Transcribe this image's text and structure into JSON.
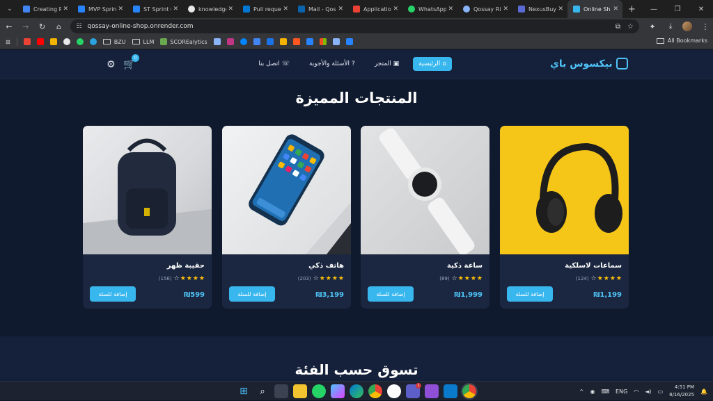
{
  "browser": {
    "tabs": [
      {
        "title": "Creating P",
        "color": "#4285f4"
      },
      {
        "title": "MVP Sprin",
        "color": "#2684ff"
      },
      {
        "title": "ST Sprint 6",
        "color": "#2684ff"
      },
      {
        "title": "knowledge",
        "color": "#e8e8e8"
      },
      {
        "title": "Pull reque",
        "color": "#0078d4"
      },
      {
        "title": "Mail - Qos",
        "color": "#0a64ad"
      },
      {
        "title": "Application",
        "color": "#ea4335"
      },
      {
        "title": "WhatsApp",
        "color": "#25d366"
      },
      {
        "title": "Qossay Ri",
        "color": "#8ab4f8"
      },
      {
        "title": "NexusBuy",
        "color": "#5b6bd6"
      },
      {
        "title": "Online Sh",
        "color": "#38b6ee"
      }
    ],
    "new_tab": "+",
    "url": "qossay-online-shop.onrender.com",
    "bookmarks": [
      "BZU",
      "LLM",
      "SCOREalytics"
    ],
    "all_bookmarks": "All Bookmarks"
  },
  "site": {
    "brand": "نيكسوس باي",
    "nav": {
      "home": "الرئيسية",
      "store": "المتجر",
      "faq": "الأسئلة والأجوبة",
      "contact": "اتصل بنا"
    },
    "cart_count": "0",
    "featured_title": "المنتجات المميزة",
    "category_title": "تسوق حسب الفئة",
    "add_to_cart": "إضافة للسلة",
    "products": [
      {
        "name": "سماعات لاسلكية",
        "price": "₪1,199",
        "reviews": "(124)",
        "stars": 4
      },
      {
        "name": "ساعة ذكية",
        "price": "₪1,999",
        "reviews": "(89)",
        "stars": 4
      },
      {
        "name": "هاتف ذكي",
        "price": "₪3,199",
        "reviews": "(203)",
        "stars": 4
      },
      {
        "name": "حقيبة ظهر",
        "price": "₪599",
        "reviews": "(156)",
        "stars": 4
      }
    ]
  },
  "taskbar": {
    "lang": "ENG",
    "time": "4:51 PM",
    "date": "8/16/2025",
    "notification_count": "1"
  }
}
